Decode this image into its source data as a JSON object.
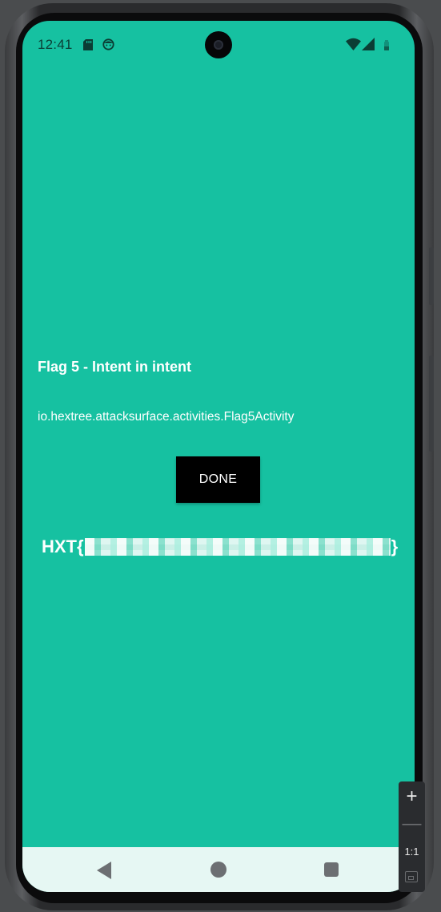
{
  "status_bar": {
    "time": "12:41",
    "icons": [
      "sd-card-icon",
      "face-icon",
      "wifi-icon",
      "signal-icon",
      "battery-icon"
    ]
  },
  "activity": {
    "title": "Flag 5 - Intent in intent",
    "activity_name": "io.hextree.attacksurface.activities.Flag5Activity",
    "done_label": "DONE",
    "flag_prefix": "HXT{",
    "flag_suffix": "}"
  },
  "nav_bar": {
    "icons": [
      "back-icon",
      "home-icon",
      "recents-icon"
    ]
  },
  "zoom_control": {
    "zoom_in": "+",
    "zoom_out": "—",
    "ratio": "1:1",
    "icons": [
      "zoom-in-icon",
      "zoom-out-icon",
      "fit-screen-icon"
    ]
  },
  "colors": {
    "screen_background": "#16c1a1",
    "button_background": "#000000",
    "text": "#ffffff",
    "nav_background": "#e6f7f3"
  }
}
